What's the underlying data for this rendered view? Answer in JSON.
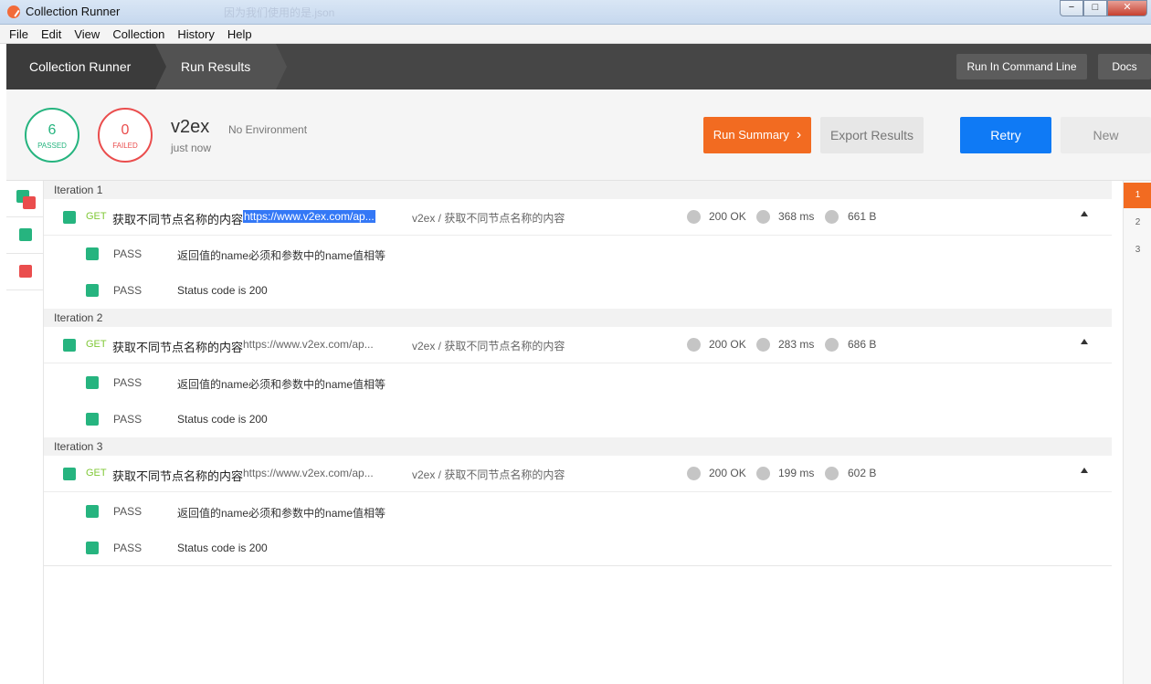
{
  "window": {
    "title": "Collection Runner",
    "ghost_text": "因为我们使用的是.json",
    "controls": {
      "minimize": "−",
      "maximize": "□",
      "close": "✕"
    }
  },
  "menu": [
    "File",
    "Edit",
    "View",
    "Collection",
    "History",
    "Help"
  ],
  "header": {
    "crumbs": [
      "Collection Runner",
      "Run Results"
    ],
    "run_in_command_line": "Run In Command Line",
    "docs": "Docs"
  },
  "summary": {
    "passed_count": "6",
    "passed_label": "PASSED",
    "failed_count": "0",
    "failed_label": "FAILED",
    "collection_name": "v2ex",
    "environment": "No Environment",
    "time": "just now",
    "run_summary": "Run Summary",
    "export_results": "Export Results",
    "retry": "Retry",
    "new": "New"
  },
  "iterations": [
    {
      "label": "Iteration 1",
      "request": {
        "method": "GET",
        "name": "获取不同节点名称的内容",
        "url": "https://www.v2ex.com/ap...",
        "path": "v2ex / 获取不同节点名称的内容",
        "status": "200 OK",
        "time": "368 ms",
        "size": "661 B"
      },
      "tests": [
        {
          "status": "PASS",
          "name": "返回值的name必须和参数中的name值相等"
        },
        {
          "status": "PASS",
          "name": "Status code is 200"
        }
      ]
    },
    {
      "label": "Iteration 2",
      "request": {
        "method": "GET",
        "name": "获取不同节点名称的内容",
        "url": "https://www.v2ex.com/ap...",
        "path": "v2ex / 获取不同节点名称的内容",
        "status": "200 OK",
        "time": "283 ms",
        "size": "686 B"
      },
      "tests": [
        {
          "status": "PASS",
          "name": "返回值的name必须和参数中的name值相等"
        },
        {
          "status": "PASS",
          "name": "Status code is 200"
        }
      ]
    },
    {
      "label": "Iteration 3",
      "request": {
        "method": "GET",
        "name": "获取不同节点名称的内容",
        "url": "https://www.v2ex.com/ap...",
        "path": "v2ex / 获取不同节点名称的内容",
        "status": "200 OK",
        "time": "199 ms",
        "size": "602 B"
      },
      "tests": [
        {
          "status": "PASS",
          "name": "返回值的name必须和参数中的name值相等"
        },
        {
          "status": "PASS",
          "name": "Status code is 200"
        }
      ]
    }
  ],
  "iteration_numbers": [
    "1",
    "2",
    "3"
  ],
  "colors": {
    "pass": "#26b47f",
    "fail": "#ea4d4d",
    "accent": "#f26b21",
    "primary": "#0f7af5"
  }
}
